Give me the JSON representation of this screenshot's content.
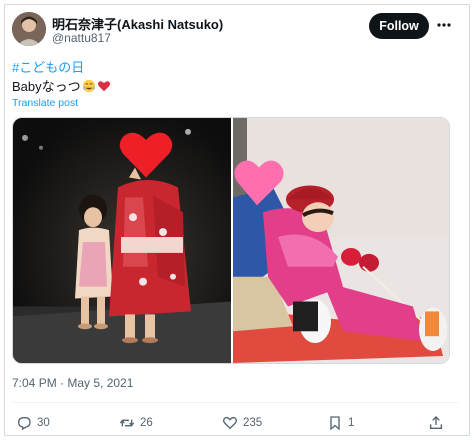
{
  "author": {
    "name": "明石奈津子(Akashi Natsuko)",
    "handle": "@nattu817"
  },
  "header": {
    "follow_label": "Follow",
    "more_icon": "more-horizontal-icon"
  },
  "tweet": {
    "hashtag": "#こどもの日",
    "text": "Babyなっつ",
    "emojis": [
      "tears-of-joy-emoji",
      "heart-emoji"
    ],
    "translate_label": "Translate post"
  },
  "media": {
    "photos": [
      "photo-child-in-kimono",
      "photo-children-sledding"
    ]
  },
  "timestamp": "7:04 PM · May 5, 2021",
  "actions": {
    "reply": {
      "icon": "reply-icon",
      "count": "30"
    },
    "retweet": {
      "icon": "retweet-icon",
      "count": "26"
    },
    "like": {
      "icon": "like-icon",
      "count": "235"
    },
    "bookmark": {
      "icon": "bookmark-icon",
      "count": "1"
    },
    "share": {
      "icon": "share-icon"
    }
  },
  "colors": {
    "link": "#1d9bf0",
    "text": "#0f1419",
    "secondary": "#536471",
    "follow_bg": "#0f1419",
    "heart_red": "#f2264f"
  }
}
